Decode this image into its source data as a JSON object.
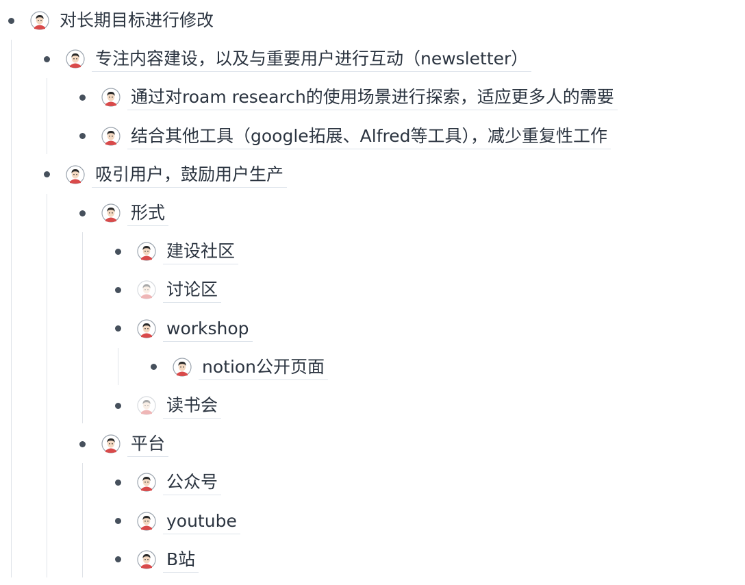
{
  "blocks": [
    {
      "text": "对长期目标进行修改",
      "depth": 0,
      "avatar": "avatar-icon",
      "faded": false,
      "underline": false
    },
    {
      "text": "专注内容建设，以及与重要用户进行互动（newsletter）",
      "depth": 1,
      "avatar": "avatar-icon",
      "faded": false,
      "underline": true
    },
    {
      "text": "通过对roam research的使用场景进行探索，适应更多人的需要",
      "depth": 2,
      "avatar": "avatar-icon",
      "faded": false,
      "underline": true
    },
    {
      "text": "结合其他工具（google拓展、Alfred等工具），减少重复性工作",
      "depth": 2,
      "avatar": "avatar-icon",
      "faded": false,
      "underline": true
    },
    {
      "text": "吸引用户，鼓励用户生产",
      "depth": 1,
      "avatar": "avatar-icon",
      "faded": false,
      "underline": true
    },
    {
      "text": "形式",
      "depth": 2,
      "avatar": "avatar-icon",
      "faded": false,
      "underline": true
    },
    {
      "text": "建设社区",
      "depth": 3,
      "avatar": "avatar-icon",
      "faded": false,
      "underline": true
    },
    {
      "text": "讨论区",
      "depth": 3,
      "avatar": "avatar-icon",
      "faded": true,
      "underline": true
    },
    {
      "text": "workshop",
      "depth": 3,
      "avatar": "avatar-icon",
      "faded": false,
      "underline": true
    },
    {
      "text": "notion公开页面",
      "depth": 4,
      "avatar": "avatar-icon",
      "faded": false,
      "underline": true
    },
    {
      "text": "读书会",
      "depth": 3,
      "avatar": "avatar-icon",
      "faded": true,
      "underline": true
    },
    {
      "text": "平台",
      "depth": 2,
      "avatar": "avatar-icon",
      "faded": false,
      "underline": true
    },
    {
      "text": "公众号",
      "depth": 3,
      "avatar": "avatar-icon",
      "faded": false,
      "underline": true
    },
    {
      "text": "youtube",
      "depth": 3,
      "avatar": "avatar-icon",
      "faded": false,
      "underline": true
    },
    {
      "text": "B站",
      "depth": 3,
      "avatar": "avatar-icon",
      "faded": false,
      "underline": true
    }
  ],
  "colors": {
    "text": "#2b3440",
    "bullet": "#46505c",
    "guide_line": "#dfe3e8",
    "underline": "#dde3ea",
    "avatar_shirt": "#d94a4a",
    "avatar_hair": "#2a2a2a",
    "avatar_skin": "#f4d9c2"
  }
}
